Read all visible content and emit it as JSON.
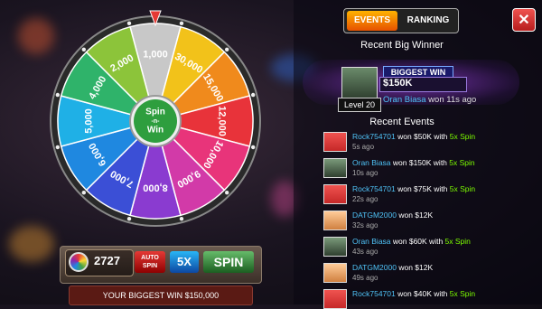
{
  "wheel": {
    "center_label": [
      "Spin",
      "-n-",
      "Win"
    ],
    "segments": [
      {
        "label": "1,000",
        "color": "#c8c8c8"
      },
      {
        "label": "30,000",
        "color": "#f2c21a"
      },
      {
        "label": "15,000",
        "color": "#f08a1c"
      },
      {
        "label": "12,000",
        "color": "#e8333a"
      },
      {
        "label": "10,000",
        "color": "#e8347a"
      },
      {
        "label": "9,000",
        "color": "#d23aa8"
      },
      {
        "label": "8,000",
        "color": "#8a3bd0"
      },
      {
        "label": "7,000",
        "color": "#3b4fd6"
      },
      {
        "label": "6,000",
        "color": "#1f88e0"
      },
      {
        "label": "5,000",
        "color": "#1fb0e6"
      },
      {
        "label": "4,000",
        "color": "#2fb36a"
      },
      {
        "label": "2,000",
        "color": "#8cc43a"
      }
    ]
  },
  "controls": {
    "coins": "2727",
    "auto_spin": [
      "AUTO",
      "SPIN"
    ],
    "multiplier": "5X",
    "spin": "SPIN",
    "biggest_win": "YOUR BIGGEST WIN $150,000"
  },
  "panel": {
    "tabs": {
      "events": "EVENTS",
      "ranking": "RANKING"
    },
    "close": "✕",
    "recent_winner_title": "Recent Big Winner",
    "winner": {
      "badge": "BIGGEST WIN",
      "amount": "$150K",
      "level": "Level 20",
      "name": "Oran Biasa",
      "won_text": " won 11s ago"
    },
    "recent_events_title": "Recent Events",
    "events": [
      {
        "user": "Rock754701",
        "text": " won $50K with ",
        "bonus": "5x Spin",
        "time": "5s ago",
        "avatar": "red"
      },
      {
        "user": "Oran Biasa",
        "text": " won $150K with ",
        "bonus": "5x Spin",
        "time": "10s ago",
        "avatar": "photo"
      },
      {
        "user": "Rock754701",
        "text": " won $75K with ",
        "bonus": "5x Spin",
        "time": "22s ago",
        "avatar": "red"
      },
      {
        "user": "DATGM2000",
        "text": " won $12K",
        "bonus": "",
        "time": "32s ago",
        "avatar": "face"
      },
      {
        "user": "Oran Biasa",
        "text": " won $60K with ",
        "bonus": "5x Spin",
        "time": "43s ago",
        "avatar": "photo"
      },
      {
        "user": "DATGM2000",
        "text": " won $12K",
        "bonus": "",
        "time": "49s ago",
        "avatar": "face"
      },
      {
        "user": "Rock754701",
        "text": " won $40K with ",
        "bonus": "5x Spin",
        "time": "",
        "avatar": "red"
      }
    ]
  }
}
